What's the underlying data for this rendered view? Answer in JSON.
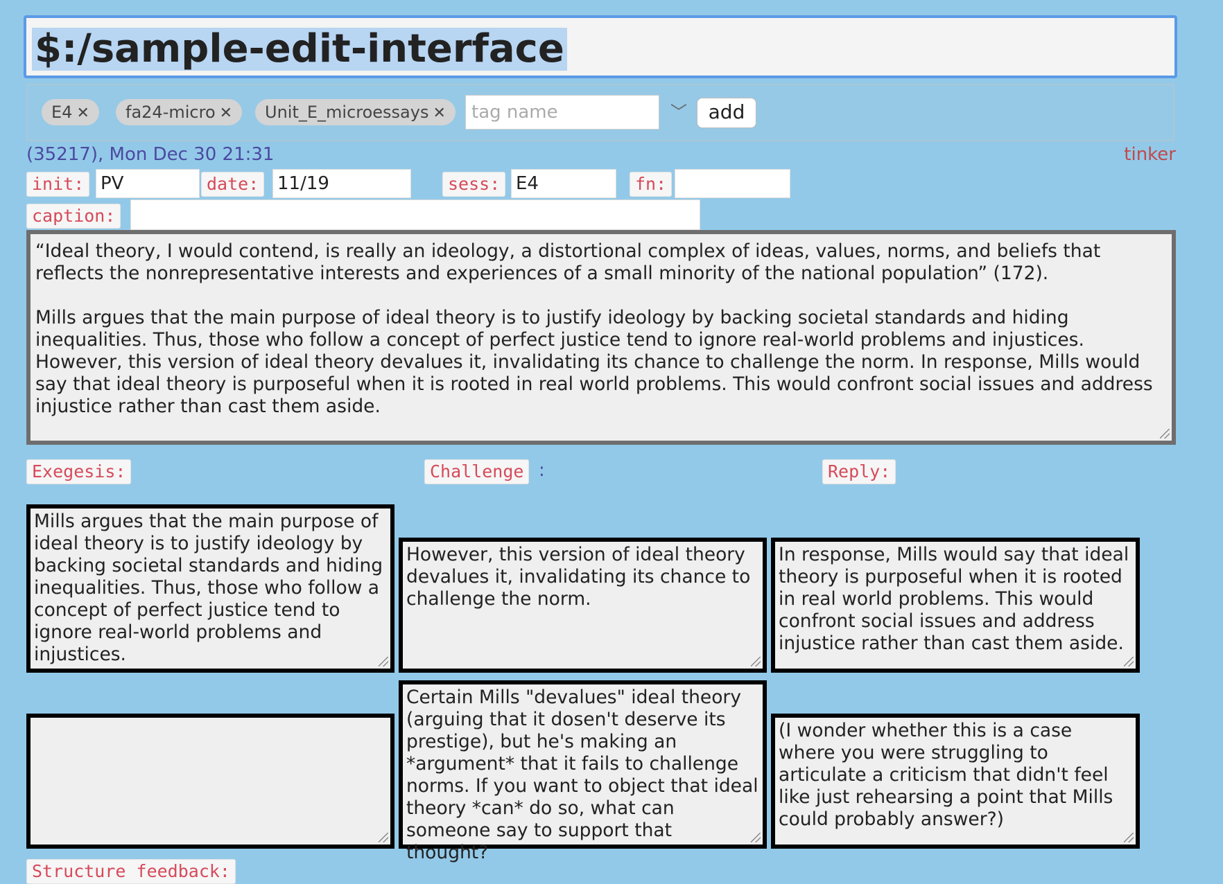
{
  "title": "$:/sample-edit-interface",
  "tags": [
    {
      "label": "E4"
    },
    {
      "label": "fa24-micro"
    },
    {
      "label": "Unit_E_microessays"
    }
  ],
  "tag_input": {
    "placeholder": "tag name",
    "add_label": "add"
  },
  "meta": {
    "left": "(35217), Mon Dec 30 21:31",
    "right": "tinker"
  },
  "fields": {
    "init_label": "init:",
    "init_value": "PV",
    "date_label": "date:",
    "date_value": "11/19",
    "sess_label": "sess:",
    "sess_value": "E4",
    "fn_label": "fn:",
    "fn_value": "",
    "caption_label": "caption:",
    "caption_value": ""
  },
  "main_text": {
    "p1": "“Ideal theory, I would contend, is really an ideology, a distortional complex of ideas, values, norms, and beliefs that reflects the nonrepresentative interests and experiences of a small minority of the national population” (172).",
    "p2": "Mills argues that the main purpose of ideal theory is to justify ideology by backing societal standards and hiding inequalities. Thus, those who follow a concept of perfect justice tend to ignore real-world problems and injustices. However, this version of ideal theory devalues it, invalidating its chance to challenge the norm. In response, Mills would say that ideal theory is purposeful when it is rooted in real world problems. This would confront social issues and address injustice rather than cast them aside."
  },
  "sections": {
    "exegesis_label": "Exegesis:",
    "challenge_label": "Challenge",
    "challenge_colon": ":",
    "reply_label": "Reply:"
  },
  "boxes": {
    "exegesis": "Mills argues that the main purpose of ideal theory is to justify ideology by backing societal standards and hiding inequalities. Thus, those who follow a concept of perfect justice tend to ignore real-world problems and injustices.",
    "challenge": "However, this version of ideal theory devalues it, invalidating its chance to challenge the norm.",
    "reply": "In response, Mills would say that ideal theory is purposeful when it is rooted in real world problems. This would confront social issues and address injustice rather than cast them aside.",
    "exegesis_feedback": "",
    "challenge_feedback": "Certain Mills \"devalues\" ideal theory (arguing that it dosen't deserve its prestige), but he's making an *argument* that it fails to challenge norms. If you want to object that ideal theory *can* do so, what can someone say to support that thought?",
    "reply_feedback": "(I wonder whether this is a case where you were struggling to articulate a criticism that didn't feel like just rehearsing a point that Mills could probably answer?)"
  },
  "bottom_label": "Structure feedback:"
}
